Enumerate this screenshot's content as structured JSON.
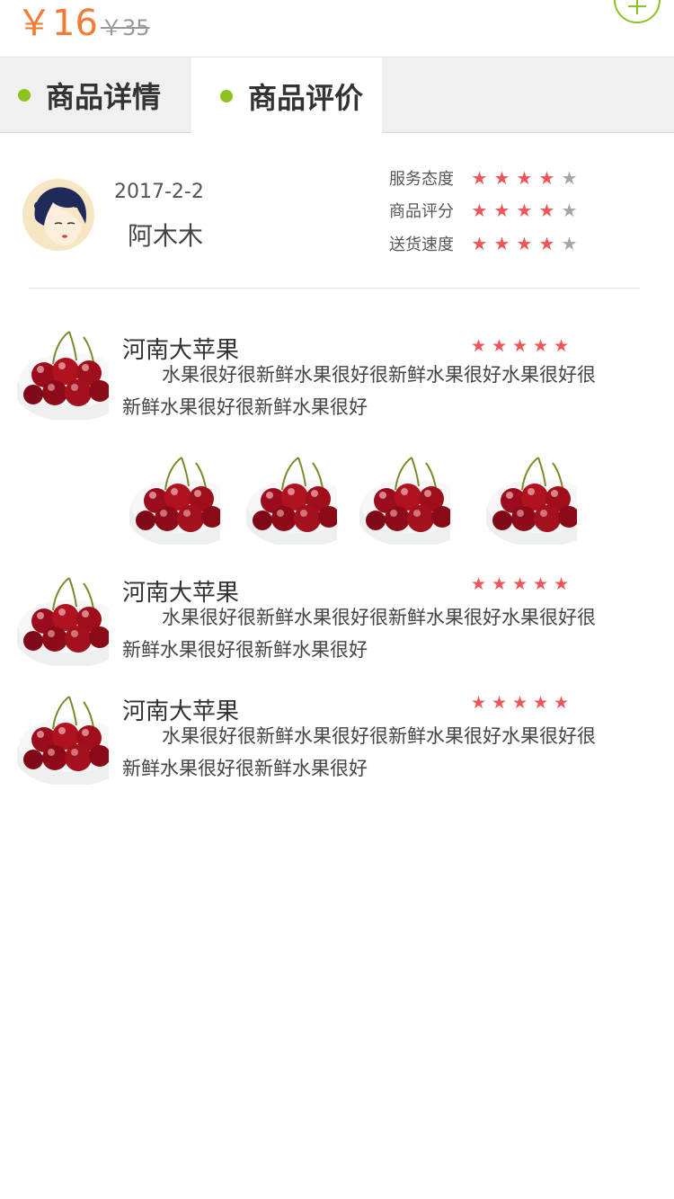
{
  "price": {
    "current": "￥16",
    "original": "￥35"
  },
  "tabs": [
    {
      "label": "商品详情",
      "active": false
    },
    {
      "label": "商品评价",
      "active": true
    }
  ],
  "reviewer": {
    "date": "2017-2-2",
    "name": "阿木木",
    "ratings": [
      {
        "label": "服务态度",
        "stars": 4,
        "max": 5
      },
      {
        "label": "商品评分",
        "stars": 4,
        "max": 5
      },
      {
        "label": "送货速度",
        "stars": 4,
        "max": 5
      }
    ]
  },
  "reviews": [
    {
      "title": "河南大苹果",
      "stars": 5,
      "text": "水果很好很新鲜水果很好很新鲜水果很好水果很好很新鲜水果很好很新鲜水果很好"
    },
    {
      "title": "河南大苹果",
      "stars": 5,
      "text": "水果很好很新鲜水果很好很新鲜水果很好水果很好很新鲜水果很好很新鲜水果很好"
    },
    {
      "title": "河南大苹果",
      "stars": 5,
      "text": "水果很好很新鲜水果很好很新鲜水果很好水果很好很新鲜水果很好很新鲜水果很好"
    }
  ],
  "icons": {
    "add": "plus-circle-icon",
    "star": "star-icon",
    "tab_dot": "dot-icon"
  },
  "colors": {
    "price": "#f37b35",
    "accent_green": "#8cc21f",
    "star_on": "#ef5458",
    "star_off": "#a5a5a5"
  }
}
